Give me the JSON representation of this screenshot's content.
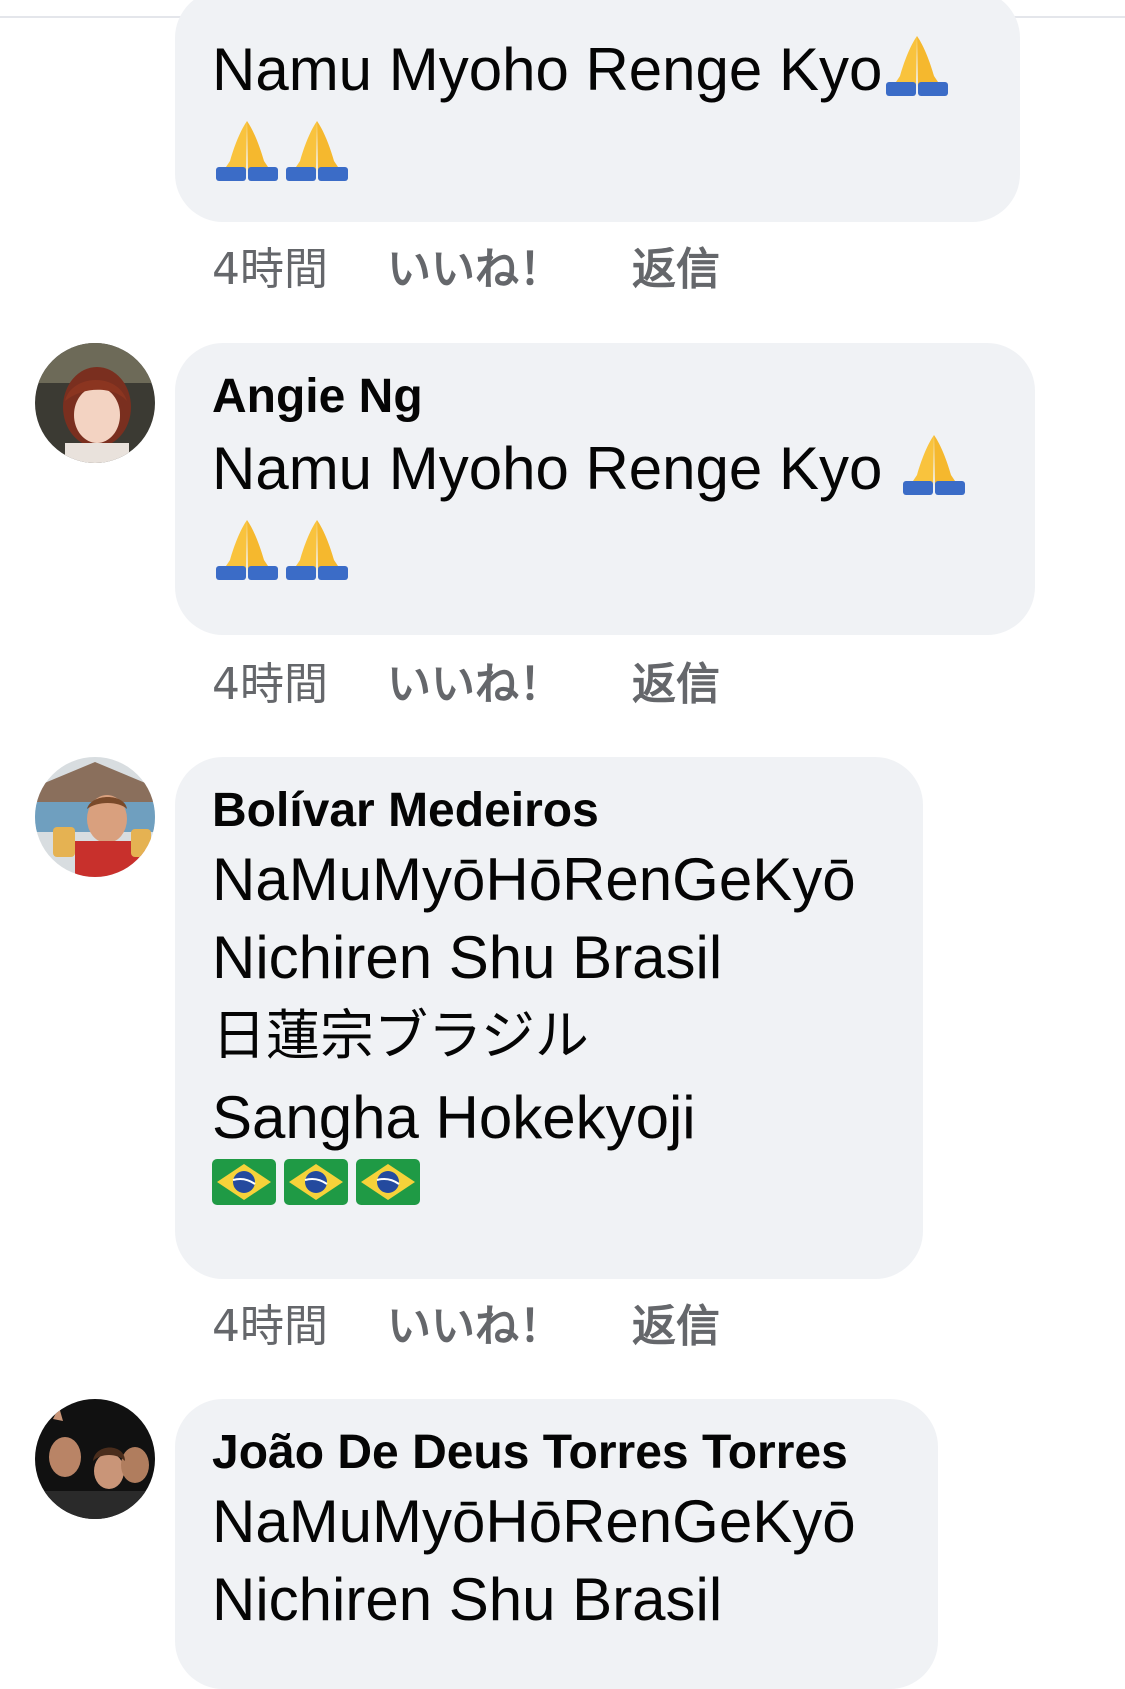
{
  "comments": [
    {
      "author": "",
      "lines": [
        "Namu Myoho Renge Kyo"
      ],
      "emoji_trailing": "folded-hands",
      "emoji_row": [
        "folded-hands",
        "folded-hands"
      ],
      "time": "4時間",
      "like": "いいね！",
      "reply": "返信"
    },
    {
      "author": "Angie Ng",
      "lines": [
        "Namu Myoho Renge Kyo "
      ],
      "emoji_trailing": "folded-hands",
      "emoji_row": [
        "folded-hands",
        "folded-hands"
      ],
      "time": "4時間",
      "like": "いいね！",
      "reply": "返信"
    },
    {
      "author": "Bolívar Medeiros",
      "lines": [
        "NaMuMyōHōRenGeKyō",
        "Nichiren Shu Brasil",
        "日蓮宗ブラジル",
        "Sangha Hokekyoji"
      ],
      "emoji_row": [
        "flag-brazil",
        "flag-brazil",
        "flag-brazil"
      ],
      "time": "4時間",
      "like": "いいね！",
      "reply": "返信"
    },
    {
      "author": "João De Deus Torres Torres",
      "lines": [
        "NaMuMyōHōRenGeKyō",
        "Nichiren Shu Brasil"
      ]
    }
  ],
  "colors": {
    "bubble": "#f0f2f5",
    "meta_text": "#65676b",
    "text": "#050505"
  }
}
